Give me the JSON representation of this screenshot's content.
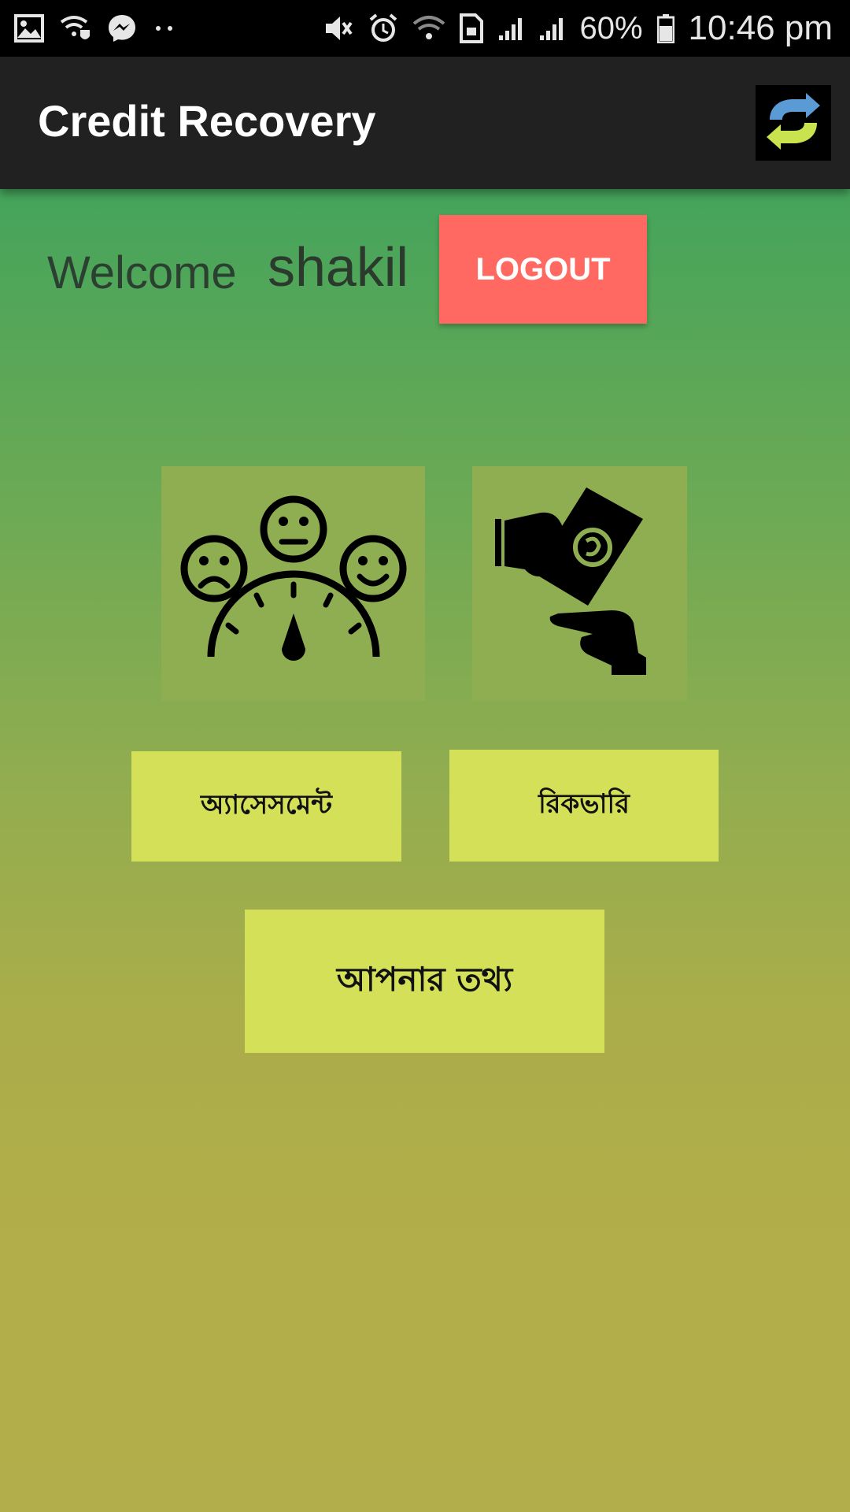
{
  "status_bar": {
    "icons_left": [
      "gallery-icon",
      "wifi-shield-icon",
      "messenger-icon",
      "more-dots-icon"
    ],
    "icons_right": [
      "mute-icon",
      "alarm-icon",
      "wifi-icon",
      "sim-icon",
      "signal-icon",
      "signal-icon",
      "battery-icon"
    ],
    "battery": "60%",
    "time": "10:46 pm"
  },
  "app_bar": {
    "title": "Credit Recovery",
    "refresh_icon": "refresh-icon"
  },
  "welcome": {
    "label": "Welcome",
    "user": "shakil",
    "logout_label": "LOGOUT"
  },
  "tiles": {
    "assessment_icon": "satisfaction-meter-icon",
    "recovery_icon": "money-hands-icon"
  },
  "buttons": {
    "assessment": "অ্যাসেসমেন্ট",
    "recovery": "রিকভারি",
    "info": "আপনার তথ্য"
  },
  "colors": {
    "app_bar": "#212121",
    "logout": "#ff6961",
    "button": "#d4e058",
    "tile": "#8fad51",
    "gradient_top": "#44a45b",
    "gradient_bottom": "#b2ae4b"
  }
}
